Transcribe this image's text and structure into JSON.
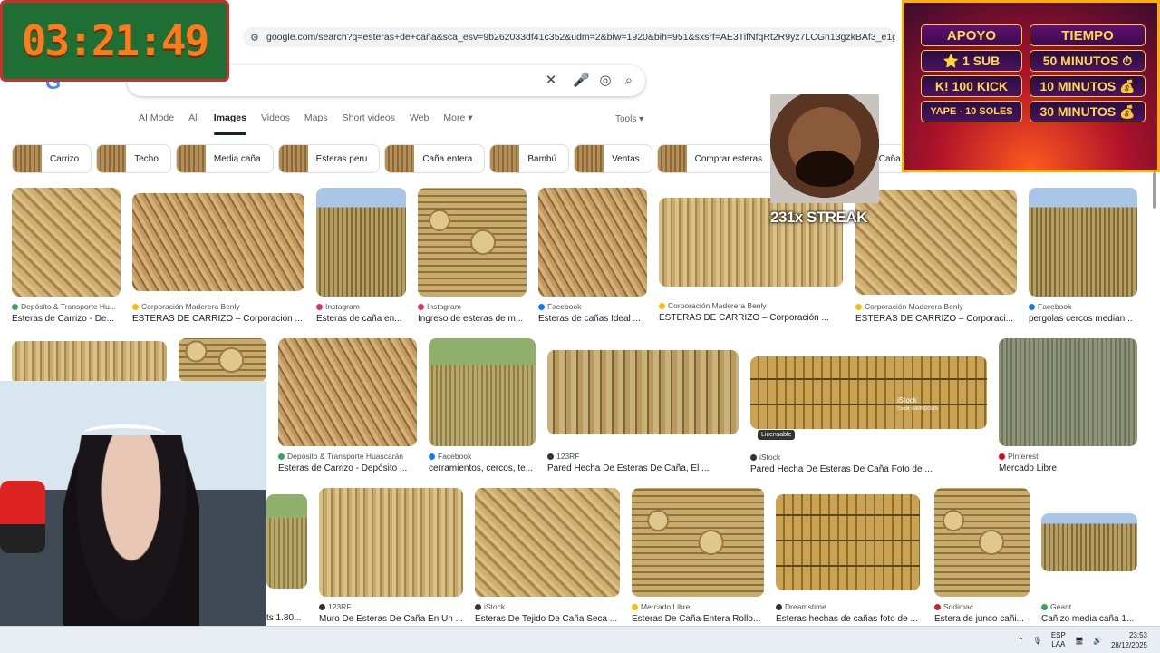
{
  "browser": {
    "url": "google.com/search?q=esteras+de+caña&sca_esv=9b262033df41c352&udm=2&biw=1920&bih=951&sxsrf=AE3TifNfqRt2R9yz7LCGn13gzkBAf3_e1g..."
  },
  "search": {
    "query": "esteras de caña"
  },
  "tabs": [
    "AI Mode",
    "All",
    "Images",
    "Videos",
    "Maps",
    "Short videos",
    "Web",
    "More ▾"
  ],
  "tools_label": "Tools ▾",
  "chips": [
    "Carrizo",
    "Techo",
    "Media caña",
    "Esteras peru",
    "Caña entera",
    "Bambú",
    "Ventas",
    "Comprar esteras",
    "V",
    "Caña"
  ],
  "results": {
    "row1": [
      {
        "source": "Depósito & Transporte Hu...",
        "title": "Esteras de Carrizo - De...",
        "color": "#34a853"
      },
      {
        "source": "Corporación Maderera Benly",
        "title": "ESTERAS DE CARRIZO – Corporación ...",
        "color": "#fbbc05"
      },
      {
        "source": "Instagram",
        "title": "Esteras de caña en...",
        "color": "#e1306c"
      },
      {
        "source": "Instagram",
        "title": "Ingreso de esteras de m...",
        "color": "#e1306c"
      },
      {
        "source": "Facebook",
        "title": "Esteras de cañas Ideal ...",
        "color": "#1877f2"
      },
      {
        "source": "Corporación Maderera Benly",
        "title": "ESTERAS DE CARRIZO – Corporación ...",
        "color": "#fbbc05"
      },
      {
        "source": "Corporación Maderera Benly",
        "title": "ESTERAS DE CARRIZO – Corporaci...",
        "color": "#fbbc05"
      },
      {
        "source": "Facebook",
        "title": "pergolas cercos median...",
        "color": "#1877f2"
      }
    ],
    "row2": [
      {
        "source": "Depósito & Transporte Huascarán",
        "title": "Esteras de Carrizo - Depósito ...",
        "color": "#34a853"
      },
      {
        "source": "Facebook",
        "title": "cerramientos, cercos, te...",
        "color": "#1877f2"
      },
      {
        "source": "123RF",
        "title": "Pared Hecha De Esteras De Caña, El ...",
        "color": "#333333"
      },
      {
        "source": "iStock",
        "title": "Pared Hecha De Esteras De Caña Foto de ...",
        "color": "#333333"
      },
      {
        "source": "Pinterest",
        "title": "Mercado Libre",
        "color": "#e60023"
      }
    ],
    "row3": [
      {
        "source": "",
        "title": "ts 1.80...",
        "color": "#ffffff"
      },
      {
        "source": "123RF",
        "title": "Muro De Esteras De Caña En Un ...",
        "color": "#333333"
      },
      {
        "source": "iStock",
        "title": "Esteras De Tejido De Caña Seca ...",
        "color": "#333333"
      },
      {
        "source": "Mercado Libre",
        "title": "Esteras De Caña Entera Rollo...",
        "color": "#fbbc05"
      },
      {
        "source": "Dreamstime",
        "title": "Esteras hechas de cañas foto de ...",
        "color": "#333333"
      },
      {
        "source": "Sodimac",
        "title": "Estera de junco cañi...",
        "color": "#c62828"
      },
      {
        "source": "Géant",
        "title": "Cañizo media caña 1...",
        "color": "#34a853"
      }
    ]
  },
  "badges": {
    "licensable": "Licensable",
    "istock_watermark": "iStock",
    "istock_credit": "Credit: GWINDOLIN"
  },
  "overlays": {
    "timer": "03:21:49",
    "streak": "231x STREAK",
    "promo": [
      "APOYO",
      "TIEMPO",
      "⭐ 1 SUB",
      "50 MINUTOS ⏱",
      "K! 100 KICK",
      "10 MINUTOS 💰",
      "YAPE - 10 SOLES",
      "30 MINUTOS 💰"
    ]
  },
  "taskbar": {
    "lang1": "ESP",
    "lang2": "LAA",
    "time": "23:53",
    "date": "28/12/2025"
  }
}
